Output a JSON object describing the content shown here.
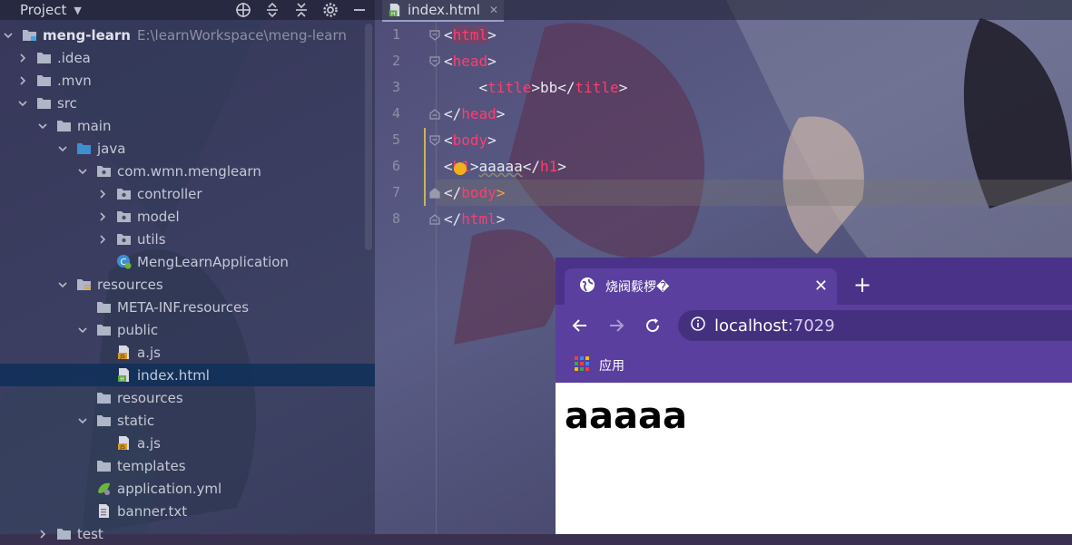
{
  "project": {
    "title": "Project",
    "tree": [
      {
        "label": "meng-learn",
        "path": "E:\\learnWorkspace\\meng-learn",
        "icon": "module-folder-icon",
        "expanded": true
      },
      {
        "label": ".idea",
        "icon": "folder-icon",
        "expanded": false
      },
      {
        "label": ".mvn",
        "icon": "folder-icon",
        "expanded": false
      },
      {
        "label": "src",
        "icon": "folder-icon",
        "expanded": true
      },
      {
        "label": "main",
        "icon": "folder-icon",
        "expanded": true
      },
      {
        "label": "java",
        "icon": "source-folder-icon",
        "expanded": true
      },
      {
        "label": "com.wmn.menglearn",
        "icon": "package-icon",
        "expanded": true
      },
      {
        "label": "controller",
        "icon": "package-icon",
        "expanded": false
      },
      {
        "label": "model",
        "icon": "package-icon",
        "expanded": false
      },
      {
        "label": "utils",
        "icon": "package-icon",
        "expanded": false
      },
      {
        "label": "MengLearnApplication",
        "icon": "spring-boot-class-icon"
      },
      {
        "label": "resources",
        "icon": "resources-folder-icon",
        "expanded": true
      },
      {
        "label": "META-INF.resources",
        "icon": "folder-icon"
      },
      {
        "label": "public",
        "icon": "folder-icon",
        "expanded": true
      },
      {
        "label": "a.js",
        "icon": "js-file-icon"
      },
      {
        "label": "index.html",
        "icon": "html-file-icon",
        "selected": true
      },
      {
        "label": "resources",
        "icon": "folder-icon"
      },
      {
        "label": "static",
        "icon": "folder-icon",
        "expanded": true
      },
      {
        "label": "a.js",
        "icon": "js-file-icon"
      },
      {
        "label": "templates",
        "icon": "folder-icon"
      },
      {
        "label": "application.yml",
        "icon": "yml-config-icon"
      },
      {
        "label": "banner.txt",
        "icon": "text-file-icon"
      },
      {
        "label": "test",
        "icon": "folder-icon",
        "expanded": false
      }
    ]
  },
  "editor": {
    "tab_label": "index.html",
    "line_numbers": [
      "1",
      "2",
      "3",
      "4",
      "5",
      "6",
      "7",
      "8"
    ],
    "code": [
      {
        "t1": "<",
        "tag": "html",
        "t2": ">"
      },
      {
        "t1": "<",
        "tag": "head",
        "t2": ">"
      },
      {
        "t1": "    <",
        "tag": "title",
        "t2": ">",
        "text": "bb",
        "t3": "</",
        "tag2": "title",
        "t4": ">"
      },
      {
        "t1": "</",
        "tag": "head",
        "t2": ">"
      },
      {
        "t1": "<",
        "tag": "body",
        "t2": ">"
      },
      {
        "t1": "<",
        "tag": "h1",
        "t2": ">",
        "text": "aaaaa",
        "t3": "</",
        "tag2": "h1",
        "t4": ">"
      },
      {
        "t1": "</",
        "tag": "body",
        "t2": ">"
      },
      {
        "t1": "</",
        "tag": "html",
        "t2": ">"
      }
    ]
  },
  "browser": {
    "tab_title": "烧阀鬏椤�",
    "url_host": "localhost",
    "url_port": ":7029",
    "bookmark_label": "应用",
    "page_heading": "aaaaa"
  },
  "colors": {
    "tag": "#ff3d6e",
    "browser_frame": "#5a3f9e",
    "selection": "#10305a"
  }
}
